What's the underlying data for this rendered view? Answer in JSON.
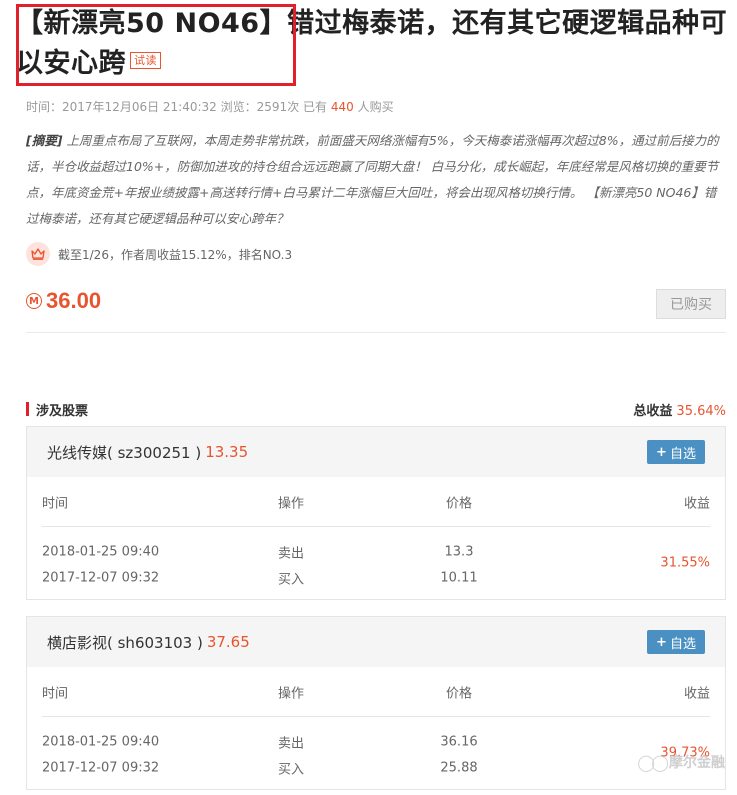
{
  "article": {
    "title": "【新漂亮50 NO46】错过梅泰诺，还有其它硬逻辑品种可以安心跨",
    "trial_badge": "试读",
    "meta_time_label": "时间：",
    "meta_time": "2017年12月06日 21:40:32",
    "meta_views_label": "浏览：",
    "meta_views": "2591次",
    "meta_bought_prefix": "已有",
    "meta_bought_count": "440",
    "meta_bought_suffix": "人购买",
    "summary_tag": "[摘要]",
    "summary_text": "上周重点布局了互联网，本周走势非常抗跌，前面盛天网络涨幅有5%，今天梅泰诺涨幅再次超过8%，通过前后接力的话，半仓收益超过10%+，防御加进攻的持仓组合远远跑赢了同期大盘！ 白马分化，成长崛起，年底经常是风格切换的重要节点，年底资金荒+年报业绩披露+高送转行情+白马累计二年涨幅巨大回吐，将会出现风格切换行情。 【新漂亮50 NO46】错过梅泰诺，还有其它硬逻辑品种可以安心跨年？",
    "rank_text": "截至1/26，作者周收益15.12%，排名NO.3",
    "price": "36.00",
    "coin_symbol": "M",
    "bought_button": "已购买"
  },
  "stocks_section": {
    "title": "涉及股票",
    "total_label": "总收益",
    "total_value": "35.64%",
    "add_label": "自选",
    "headers": {
      "time": "时间",
      "op": "操作",
      "price": "价格",
      "profit": "收益"
    },
    "stocks": [
      {
        "name": "光线传媒( sz300251 )",
        "price": "13.35",
        "profit": "31.55%",
        "trades": [
          {
            "time": "2018-01-25 09:40",
            "op": "卖出",
            "price": "13.3"
          },
          {
            "time": "2017-12-07 09:32",
            "op": "买入",
            "price": "10.11"
          }
        ]
      },
      {
        "name": "横店影视( sh603103 )",
        "price": "37.65",
        "profit": "39.73%",
        "trades": [
          {
            "time": "2018-01-25 09:40",
            "op": "卖出",
            "price": "36.16"
          },
          {
            "time": "2017-12-07 09:32",
            "op": "买入",
            "price": "25.88"
          }
        ]
      }
    ]
  },
  "watermark": {
    "text": "摩尔金融"
  },
  "colors": {
    "accent": "#e8542e",
    "highlight_box": "#e0202a",
    "button_blue": "#4a90c2"
  }
}
